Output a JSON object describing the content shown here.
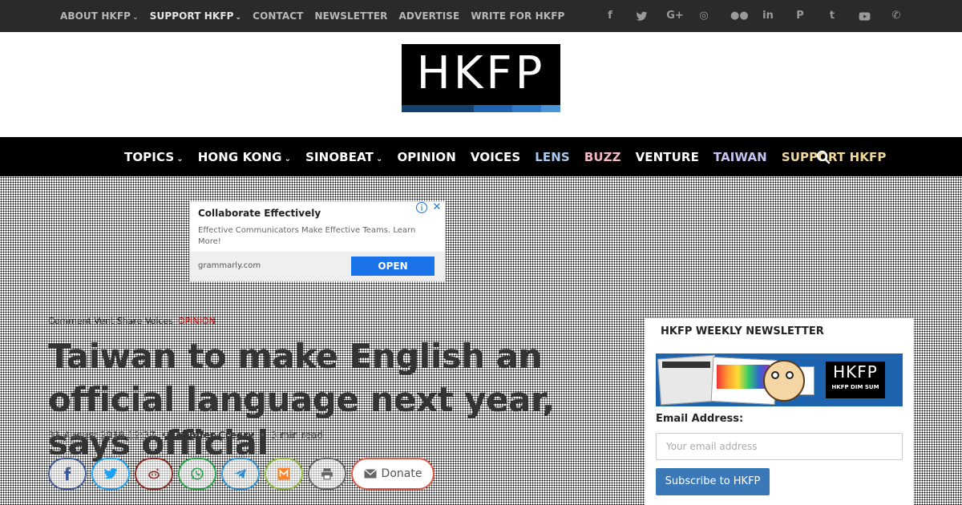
{
  "topbar": {
    "links": [
      {
        "label": "ABOUT HKFP",
        "dropdown": true,
        "highlight": false
      },
      {
        "label": "SUPPORT HKFP",
        "dropdown": true,
        "highlight": true
      },
      {
        "label": "CONTACT",
        "dropdown": false,
        "highlight": false
      },
      {
        "label": "NEWSLETTER",
        "dropdown": false,
        "highlight": false
      },
      {
        "label": "ADVERTISE",
        "dropdown": false,
        "highlight": false
      },
      {
        "label": "WRITE FOR HKFP",
        "dropdown": false,
        "highlight": false
      }
    ],
    "social_icons": [
      "facebook-icon",
      "twitter-icon",
      "google-plus-icon",
      "instagram-icon",
      "flickr-icon",
      "linkedin-icon",
      "pinterest-icon",
      "tumblr-icon",
      "youtube-icon",
      "phone-icon"
    ]
  },
  "logo": {
    "text": "HKFP"
  },
  "mainnav": {
    "items": [
      {
        "label": "TOPICS",
        "dropdown": true,
        "color": "#ffffff"
      },
      {
        "label": "HONG KONG",
        "dropdown": true,
        "color": "#ffffff"
      },
      {
        "label": "SINOBEAT",
        "dropdown": true,
        "color": "#ffffff"
      },
      {
        "label": "OPINION",
        "dropdown": false,
        "color": "#ffffff"
      },
      {
        "label": "VOICES",
        "dropdown": false,
        "color": "#ffffff"
      },
      {
        "label": "LENS",
        "dropdown": false,
        "color": "#aac8ee"
      },
      {
        "label": "BUZZ",
        "dropdown": false,
        "color": "#f2b8c6"
      },
      {
        "label": "VENTURE",
        "dropdown": false,
        "color": "#ffffff"
      },
      {
        "label": "TAIWAN",
        "dropdown": false,
        "color": "#c6c2f0"
      },
      {
        "label": "SUPPORT HKFP",
        "dropdown": false,
        "color": "#f0d89a"
      }
    ]
  },
  "ad": {
    "title": "Collaborate Effectively",
    "description": "Effective Communicators Make Effective Teams. Learn More!",
    "domain": "grammarly.com",
    "button_label": "OPEN"
  },
  "article": {
    "breadcrumb": "Comment   Vent   Share   Voices",
    "tag": "OPINION",
    "headline": "Taiwan to make English an official language next year, says official",
    "date": "31 August 2018 12:37",
    "author": "Jennifer Creery",
    "read_time": "3 min read",
    "share_buttons": [
      {
        "name": "facebook-share-button",
        "icon": "facebook-icon",
        "color": "#3b5998"
      },
      {
        "name": "twitter-share-button",
        "icon": "twitter-icon",
        "color": "#1da1f2"
      },
      {
        "name": "reddit-share-button",
        "icon": "reddit-icon",
        "color": "#8a2a1f"
      },
      {
        "name": "whatsapp-share-button",
        "icon": "whatsapp-icon",
        "color": "#25a244"
      },
      {
        "name": "telegram-share-button",
        "icon": "telegram-icon",
        "color": "#2d8fd2"
      },
      {
        "name": "mix-share-button",
        "icon": "mix-icon",
        "color": "#8ab63a"
      },
      {
        "name": "print-share-button",
        "icon": "print-icon",
        "color": "#666666"
      }
    ],
    "donate_label": "Donate"
  },
  "newsletter": {
    "title": "HKFP WEEKLY NEWSLETTER",
    "banner_text": "HKFP",
    "banner_subtext": "HKFP DIM SUM",
    "email_label": "Email Address:",
    "email_placeholder": "Your email address",
    "subscribe_label": "Subscribe to HKFP"
  }
}
